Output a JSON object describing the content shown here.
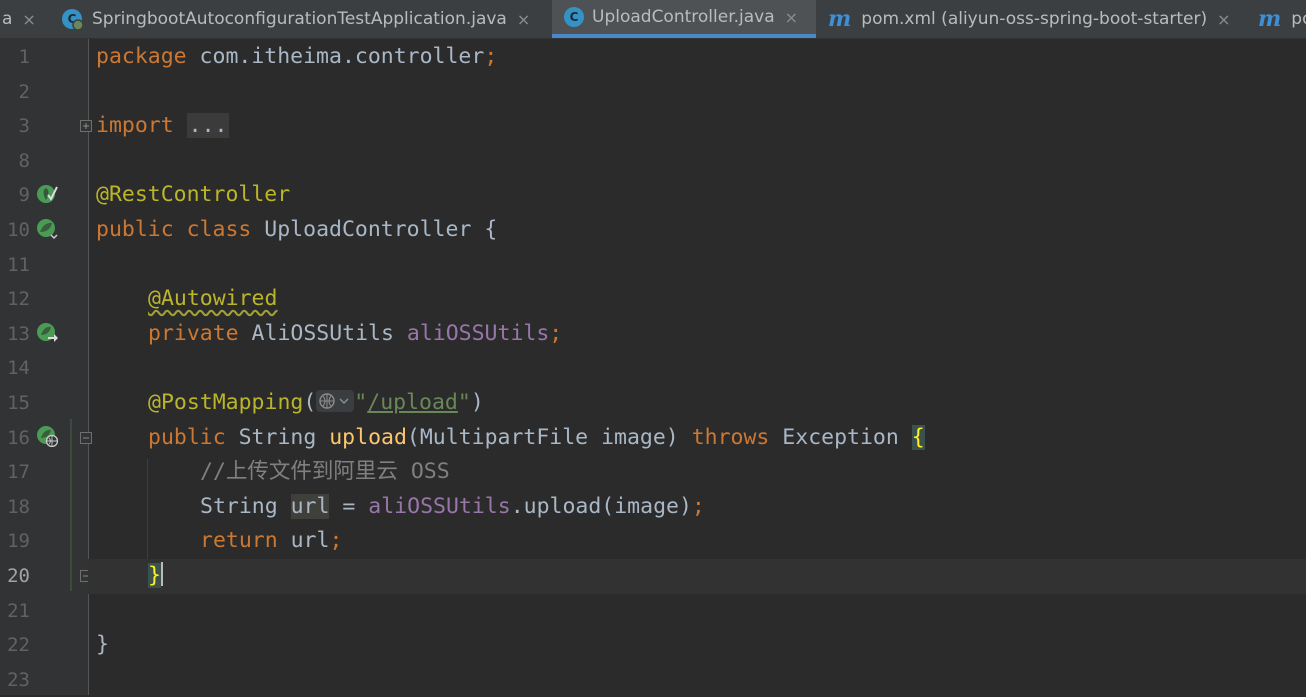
{
  "tabs": [
    {
      "label": "a",
      "icon": "java-class-icon",
      "active": false
    },
    {
      "label": "SpringbootAutoconfigurationTestApplication.java",
      "icon": "spring-boot-app-icon",
      "active": false
    },
    {
      "label": "UploadController.java",
      "icon": "java-class-icon",
      "active": true
    },
    {
      "label": "pom.xml (aliyun-oss-spring-boot-starter)",
      "icon": "maven-icon",
      "active": false
    },
    {
      "label": "po",
      "icon": "maven-icon",
      "active": false
    }
  ],
  "tab_close_glyph": "×",
  "class_icon_glyph": "C",
  "maven_icon_glyph": "m",
  "line_numbers": [
    "1",
    "2",
    "3",
    "8",
    "9",
    "10",
    "11",
    "12",
    "13",
    "14",
    "15",
    "16",
    "17",
    "18",
    "19",
    "20",
    "21",
    "22",
    "23"
  ],
  "code": {
    "l1_kw": "package",
    "l1_rest": " com.itheima.controller",
    "l1_semi": ";",
    "l3_kw": "import",
    "l3_fold": "...",
    "l9_ann": "@RestController",
    "l10_kw": "public class",
    "l10_rest": " UploadController {",
    "l12_ann": "@Autowired",
    "l13_kw": "private",
    "l13_type": " AliOSSUtils ",
    "l13_field": "aliOSSUtils",
    "l13_semi": ";",
    "l15_ann": "@PostMapping",
    "l15_open": "(",
    "l15_q1": "\"",
    "l15_path": "/upload",
    "l15_q2": "\"",
    "l15_close": ")",
    "l16_kw": "public",
    "l16_type": " String ",
    "l16_fn": "upload",
    "l16_params": "(MultipartFile image) ",
    "l16_throws": "throws",
    "l16_exc": " Exception ",
    "l16_brace": "{",
    "l17_comment": "//上传文件到阿里云 OSS",
    "l18_type": "String ",
    "l18_var": "url",
    "l18_eq": " = ",
    "l18_field": "aliOSSUtils",
    "l18_call": ".upload(image)",
    "l18_semi": ";",
    "l19_kw": "return",
    "l19_rest": " url",
    "l19_semi": ";",
    "l20_brace": "}",
    "l22_brace": "}"
  },
  "gutter_icons": [
    "bean-check-icon",
    "spring-bean-icon",
    "autowired-navigate-icon",
    "web-endpoint-icon"
  ],
  "colors": {
    "keyword": "#cc7832",
    "annotation": "#bbb529",
    "field": "#9876aa",
    "method": "#ffc66d",
    "string": "#6a8759",
    "comment": "#808080",
    "text": "#a9b7c6",
    "tab_active_underline": "#4a88c7"
  }
}
